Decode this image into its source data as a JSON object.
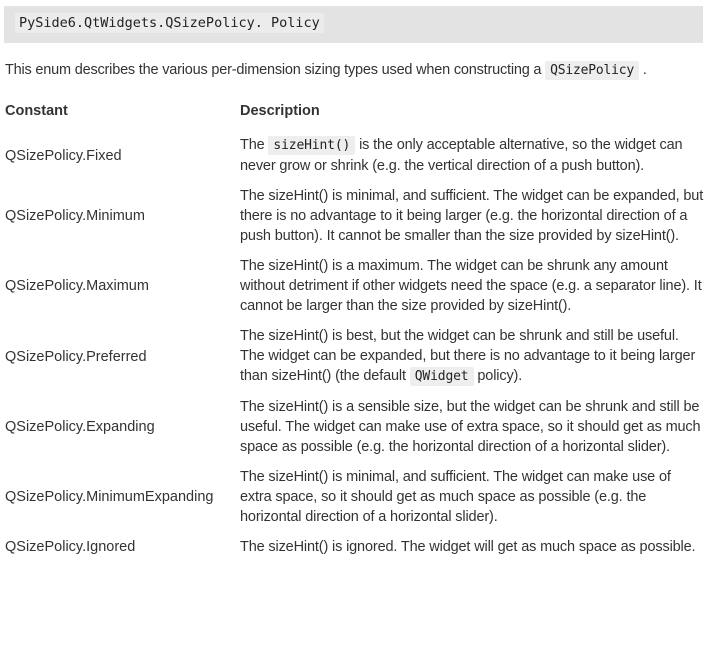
{
  "signature": "PySide6.QtWidgets.QSizePolicy. Policy",
  "intro": {
    "text": "This enum describes the various per-dimension sizing types used when constructing a ",
    "code": "QSizePolicy",
    "end": " ."
  },
  "table": {
    "headers": [
      "Constant",
      "Description"
    ],
    "rows": [
      {
        "constant": "QSizePolicy.Fixed",
        "pre": "The ",
        "code": "sizeHint()",
        "post": " is the only acceptable alternative, so the widget can never grow or shrink (e.g. the vertical direction of a push button)."
      },
      {
        "constant": "QSizePolicy.Minimum",
        "pre": "The sizeHint() is minimal, and sufficient. The widget can be expanded, but there is no advantage to it being larger (e.g. the horizontal direction of a push button). It cannot be smaller than the size provided by sizeHint().",
        "code": "",
        "post": ""
      },
      {
        "constant": "QSizePolicy.Maximum",
        "pre": "The sizeHint() is a maximum. The widget can be shrunk any amount without detriment if other widgets need the space (e.g. a separator line). It cannot be larger than the size provided by sizeHint().",
        "code": "",
        "post": ""
      },
      {
        "constant": "QSizePolicy.Preferred",
        "pre": "The sizeHint() is best, but the widget can be shrunk and still be useful. The widget can be expanded, but there is no advantage to it being larger than sizeHint() (the default ",
        "code": "QWidget",
        "post": " policy)."
      },
      {
        "constant": "QSizePolicy.Expanding",
        "pre": "The sizeHint() is a sensible size, but the widget can be shrunk and still be useful. The widget can make use of extra space, so it should get as much space as possible (e.g. the horizontal direction of a horizontal slider).",
        "code": "",
        "post": ""
      },
      {
        "constant": "QSizePolicy.MinimumExpanding",
        "pre": "The sizeHint() is minimal, and sufficient. The widget can make use of extra space, so it should get as much space as possible (e.g. the horizontal direction of a horizontal slider).",
        "code": "",
        "post": ""
      },
      {
        "constant": "QSizePolicy.Ignored",
        "pre": "The sizeHint() is ignored. The widget will get as much space as possible.",
        "code": "",
        "post": ""
      }
    ]
  }
}
